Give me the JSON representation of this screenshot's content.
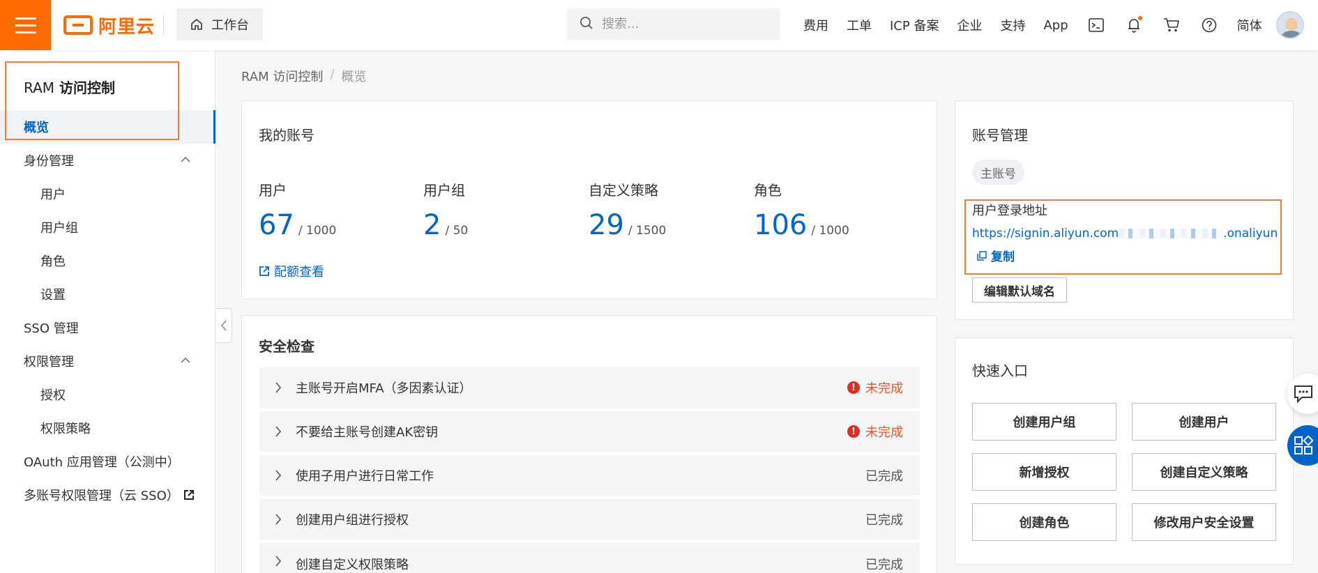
{
  "topbar": {
    "logo_text": "阿里云",
    "workbench_label": "工作台",
    "search_placeholder": "搜索...",
    "nav_links": [
      "费用",
      "工单",
      "ICP 备案",
      "企业",
      "支持",
      "App"
    ],
    "lang_label": "简体",
    "icons": [
      "terminal-icon",
      "bell-icon",
      "cart-icon",
      "help-icon"
    ]
  },
  "sidebar": {
    "title_prefix": "RAM",
    "title_main": "访问控制",
    "items": [
      {
        "label": "概览"
      },
      {
        "label": "身份管理"
      },
      {
        "label": "用户"
      },
      {
        "label": "用户组"
      },
      {
        "label": "角色"
      },
      {
        "label": "设置"
      },
      {
        "label": "SSO 管理"
      },
      {
        "label": "权限管理"
      },
      {
        "label": "授权"
      },
      {
        "label": "权限策略"
      },
      {
        "label": "OAuth 应用管理（公测中）"
      },
      {
        "label": "多账号权限管理（云 SSO）"
      }
    ]
  },
  "breadcrumb": {
    "root": "RAM 访问控制",
    "separator": "/",
    "current": "概览"
  },
  "my_account": {
    "title": "我的账号",
    "stats": [
      {
        "label": "用户",
        "value": "67",
        "limit": "/ 1000"
      },
      {
        "label": "用户组",
        "value": "2",
        "limit": "/ 50"
      },
      {
        "label": "自定义策略",
        "value": "29",
        "limit": "/ 1500"
      },
      {
        "label": "角色",
        "value": "106",
        "limit": "/ 1000"
      }
    ],
    "quota_link": "配额查看"
  },
  "security_check": {
    "title": "安全检查",
    "rows": [
      {
        "label": "主账号开启MFA（多因素认证）",
        "status": "未完成"
      },
      {
        "label": "不要给主账号创建AK密钥",
        "status": "未完成"
      },
      {
        "label": "使用子用户进行日常工作",
        "status": "已完成"
      },
      {
        "label": "创建用户组进行授权",
        "status": "已完成"
      },
      {
        "label": "创建自定义权限策略",
        "status": "已完成"
      }
    ]
  },
  "account_mgmt": {
    "title": "账号管理",
    "tag": "主账号",
    "login_url_label": "用户登录地址",
    "login_url_start": "https://signin.aliyun.com",
    "login_url_end": ".onaliyun.c",
    "copy_label": "复制",
    "edit_domain_button": "编辑默认域名"
  },
  "quick_entry": {
    "title": "快速入口",
    "buttons": [
      "创建用户组",
      "创建用户",
      "新增授权",
      "创建自定义策略",
      "创建角色",
      "修改用户安全设置"
    ]
  },
  "colors": {
    "accent": "#0064c8",
    "brand": "#ff6a00",
    "warning": "#e8542c",
    "highlight_box": "#ee7d3b"
  }
}
